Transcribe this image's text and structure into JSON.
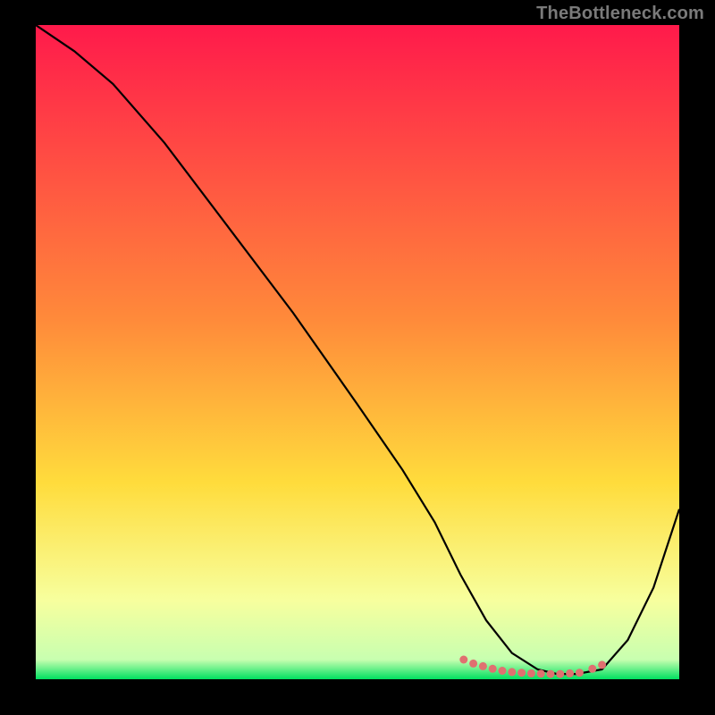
{
  "watermark": "TheBottleneck.com",
  "chart_data": {
    "type": "line",
    "title": "",
    "xlabel": "",
    "ylabel": "",
    "xlim": [
      0,
      100
    ],
    "ylim": [
      0,
      100
    ],
    "grid": false,
    "legend": false,
    "background_gradient": {
      "top_color": "#ff1a4b",
      "mid_color": "#ffdc3c",
      "low_color": "#f7ff9e",
      "bottom_color": "#00e060"
    },
    "series": [
      {
        "name": "curve",
        "color": "#000000",
        "x": [
          0,
          6,
          12,
          20,
          30,
          40,
          50,
          57,
          62,
          66,
          70,
          74,
          78,
          81,
          84,
          88,
          92,
          96,
          100
        ],
        "values": [
          100,
          96,
          91,
          82,
          69,
          56,
          42,
          32,
          24,
          16,
          9,
          4,
          1.5,
          0.8,
          0.8,
          1.5,
          6,
          14,
          26
        ]
      },
      {
        "name": "bottom-dots",
        "color": "#e07070",
        "type": "scatter",
        "x": [
          66.5,
          68,
          69.5,
          71,
          72.5,
          74,
          75.5,
          77,
          78.5,
          80,
          81.5,
          83,
          84.5,
          86.5,
          88
        ],
        "values": [
          3.0,
          2.4,
          2.0,
          1.6,
          1.3,
          1.1,
          1.0,
          0.9,
          0.85,
          0.8,
          0.8,
          0.9,
          1.0,
          1.6,
          2.2
        ]
      }
    ]
  }
}
